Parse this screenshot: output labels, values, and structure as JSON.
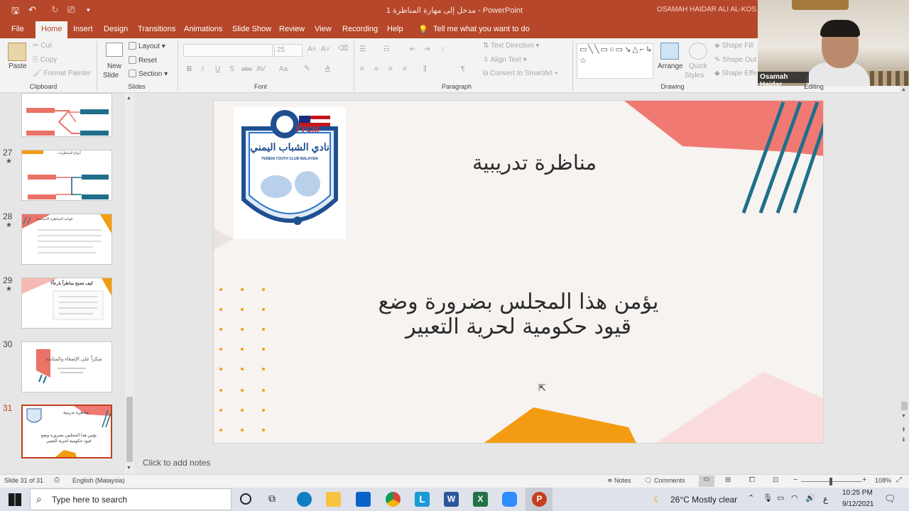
{
  "window": {
    "doc_title": "مدخل إلى مهارة المناظرة 1  -  PowerPoint",
    "user": "OSAMAH HAIDAR ALI AL-KOS"
  },
  "menu": {
    "file": "File",
    "home": "Home",
    "insert": "Insert",
    "design": "Design",
    "transitions": "Transitions",
    "animations": "Animations",
    "slide_show": "Slide Show",
    "review": "Review",
    "view": "View",
    "recording": "Recording",
    "help": "Help",
    "tell_me": "Tell me what you want to do"
  },
  "ribbon": {
    "clipboard": {
      "paste": "Paste",
      "cut": "Cut",
      "copy": "Copy",
      "format_painter": "Format Painter",
      "label": "Clipboard"
    },
    "slides": {
      "new_slide_1": "New",
      "new_slide_2": "Slide",
      "layout": "Layout",
      "reset": "Reset",
      "section": "Section",
      "label": "Slides"
    },
    "font": {
      "size": "25",
      "bold": "B",
      "italic": "I",
      "underline": "U",
      "shadow": "S",
      "strike": "abc",
      "spacing": "AV",
      "case": "Aa",
      "label": "Font"
    },
    "paragraph": {
      "text_direction": "Text Direction",
      "align_text": "Align Text",
      "convert_smartart": "Convert to SmartArt",
      "label": "Paragraph"
    },
    "drawing": {
      "arrange": "Arrange",
      "quick_styles_1": "Quick",
      "quick_styles_2": "Styles",
      "shape_fill": "Shape Fill",
      "shape_outline": "Shape Out",
      "shape_effects": "Shape Effe",
      "label": "Drawing"
    },
    "editing": {
      "label": "Editing"
    }
  },
  "webcam": {
    "name": "Osamah Haidar"
  },
  "thumbnails": [
    {
      "num": "",
      "star": false,
      "text": ""
    },
    {
      "num": "27",
      "star": true,
      "text": "أنواع المناظرات"
    },
    {
      "num": "28",
      "star": true,
      "text": "قواعد المناظرة الأساسية"
    },
    {
      "num": "29",
      "star": true,
      "text": "كيف تصبح مناظراً بارعاً؟"
    },
    {
      "num": "30",
      "star": false,
      "text": "شكراً على الإصغاء والمتابعة"
    },
    {
      "num": "31",
      "star": false,
      "text": "مناظرة تدريبية"
    }
  ],
  "slide": {
    "logo_text": "YYCM",
    "logo_caption": "YEMENI YOUTH CLUB MALAYSIA",
    "logo_arabic": "نادي الشباب اليمني",
    "title": "مناظرة تدريبية",
    "body_line1": "يؤمن هذا المجلس بضرورة وضع",
    "body_line2": "قيود حكومية لحرية التعبير"
  },
  "notes": {
    "placeholder": "Click to add notes"
  },
  "status": {
    "slide_counter": "Slide 31 of 31",
    "language": "English (Malaysia)",
    "notes": "Notes",
    "comments": "Comments",
    "zoom": "108%"
  },
  "taskbar": {
    "search_placeholder": "Type here to search",
    "weather": "26°C  Mostly clear",
    "lang": "ع",
    "time": "10:25 PM",
    "date": "9/12/2021"
  },
  "colors": {
    "accent": "#b7472a",
    "selected": "#c43e1c",
    "pink": "#f07a72",
    "teal": "#1f6f8b",
    "orange": "#f39c12"
  }
}
